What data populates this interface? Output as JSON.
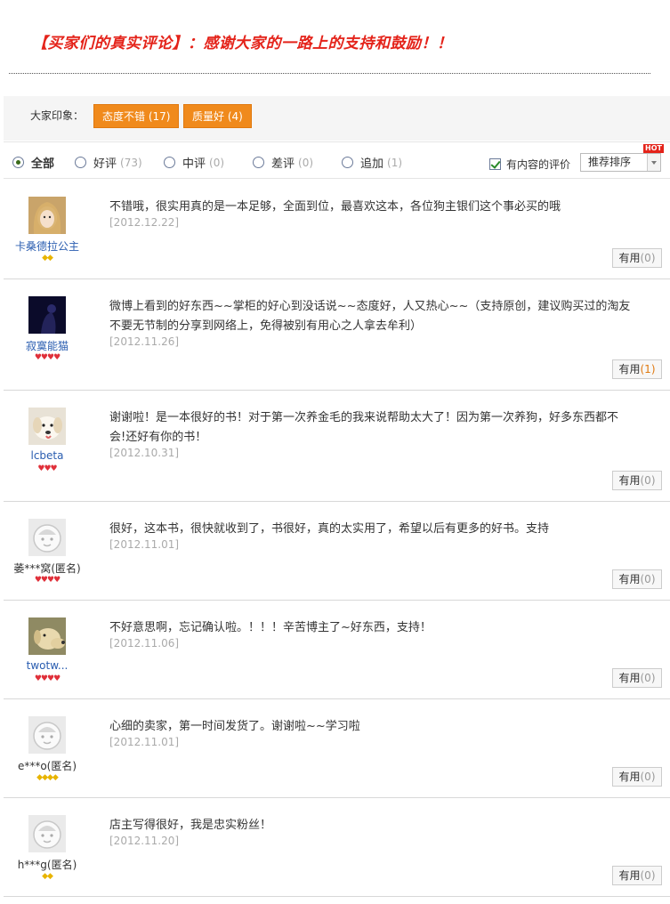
{
  "headline": "【买家们的真实评论】：感谢大家的一路上的支持和鼓励！！",
  "impression": {
    "label": "大家印象：",
    "tags": [
      {
        "text": "态度不错",
        "count": "(17)"
      },
      {
        "text": "质量好",
        "count": "(4)"
      }
    ]
  },
  "filters": [
    {
      "label": "全部",
      "count": ""
    },
    {
      "label": "好评",
      "count": "(73)"
    },
    {
      "label": "中评",
      "count": "(0)"
    },
    {
      "label": "差评",
      "count": "(0)"
    },
    {
      "label": "追加",
      "count": "(1)"
    }
  ],
  "content_only_label": "有内容的评价",
  "sort": {
    "selected": "推荐排序",
    "hot_badge": "HOT"
  },
  "useful_label": "有用",
  "reviews": [
    {
      "user": "卡桑德拉公主",
      "rank": "◆◆",
      "rank_color": "#e8b400",
      "anon": false,
      "avatar": "girl",
      "content": "不错哦，很实用真的是一本足够，全面到位，最喜欢这本，各位狗主银们这个事必买的哦",
      "date": "[2012.12.22]",
      "useful_count": "(0)"
    },
    {
      "user": "寂寞能猫",
      "rank": "♥♥♥♥",
      "rank_color": "#e0303a",
      "anon": false,
      "avatar": "dark",
      "content": "微博上看到的好东西~~掌柜的好心到没话说~~态度好，人又热心~~（支持原创，建议购买过的淘友不要无节制的分享到网络上，免得被别有用心之人拿去牟利）",
      "date": "[2012.11.26]",
      "useful_count": "(1)"
    },
    {
      "user": "lcbeta",
      "rank": "♥♥♥",
      "rank_color": "#e0303a",
      "anon": false,
      "avatar": "dog",
      "content": "谢谢啦！是一本很好的书！对于第一次养金毛的我来说帮助太大了！因为第一次养狗，好多东西都不会!还好有你的书！",
      "date": "[2012.10.31]",
      "useful_count": "(0)"
    },
    {
      "user": "萎***窝(匿名)",
      "rank": "♥♥♥♥",
      "rank_color": "#e0303a",
      "anon": true,
      "avatar": "default",
      "content": "很好，这本书，很快就收到了，书很好，真的太实用了，希望以后有更多的好书。支持",
      "date": "[2012.11.01]",
      "useful_count": "(0)"
    },
    {
      "user": "twotw...",
      "rank": "♥♥♥♥",
      "rank_color": "#e0303a",
      "anon": false,
      "avatar": "lab",
      "content": "不好意思啊，忘记确认啦。！！！辛苦博主了~好东西，支持！",
      "date": "[2012.11.06]",
      "useful_count": "(0)"
    },
    {
      "user": "e***o(匿名)",
      "rank": "◆◆◆◆",
      "rank_color": "#e8b400",
      "anon": true,
      "avatar": "default",
      "content": "心细的卖家，第一时间发货了。谢谢啦~~学习啦",
      "date": "[2012.11.01]",
      "useful_count": "(0)"
    },
    {
      "user": "h***g(匿名)",
      "rank": "◆◆",
      "rank_color": "#e8b400",
      "anon": true,
      "avatar": "default",
      "content": "店主写得很好，我是忠实粉丝！",
      "date": "[2012.11.20]",
      "useful_count": "(0)"
    }
  ]
}
